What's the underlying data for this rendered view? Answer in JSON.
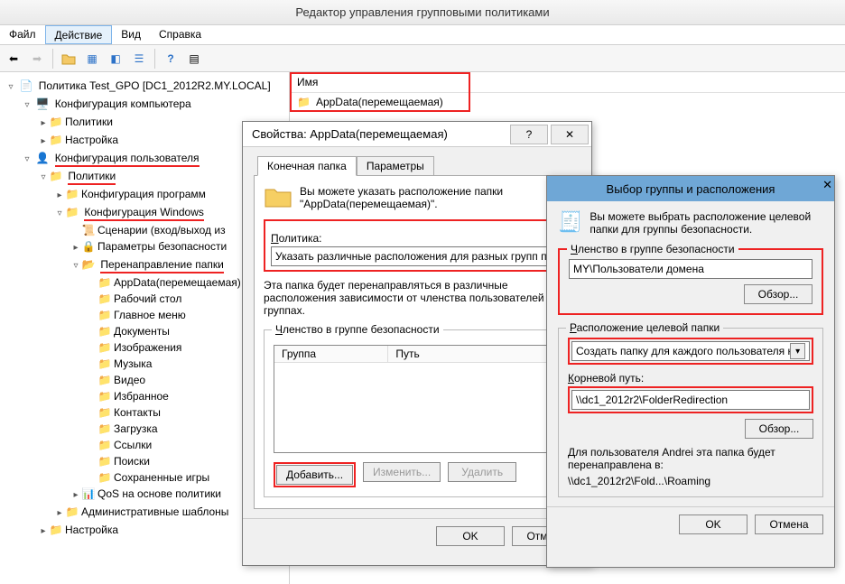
{
  "window_title": "Редактор управления групповыми политиками",
  "menu": {
    "file": "Файл",
    "action": "Действие",
    "view": "Вид",
    "help": "Справка"
  },
  "tree": {
    "root": "Политика Test_GPO [DC1_2012R2.MY.LOCAL]",
    "comp_conf": "Конфигурация компьютера",
    "policies": "Политики",
    "settings": "Настройка",
    "user_conf": "Конфигурация пользователя",
    "policies2": "Политики",
    "prog_conf": "Конфигурация программ",
    "win_conf": "Конфигурация Windows",
    "scripts": "Сценарии (вход/выход из",
    "sec_params": "Параметры безопасности",
    "folder_redir": "Перенаправление папки",
    "appdata": "AppData(перемещаемая)",
    "desktop": "Рабочий стол",
    "startmenu": "Главное меню",
    "documents": "Документы",
    "pictures": "Изображения",
    "music": "Музыка",
    "video": "Видео",
    "favorites": "Избранное",
    "contacts": "Контакты",
    "downloads": "Загрузка",
    "links": "Ссылки",
    "searches": "Поиски",
    "savedgames": "Сохраненные игры",
    "qos": "QoS на основе политики",
    "admtmpl": "Административные шаблоны",
    "settings2": "Настройка"
  },
  "list": {
    "header": "Имя",
    "row1": "AppData(перемещаемая)"
  },
  "props_dialog": {
    "title": "Свойства: AppData(перемещаемая)",
    "tab_target": "Конечная папка",
    "tab_params": "Параметры",
    "hint1": "Вы можете указать расположение папки",
    "hint2": "\"AppData(перемещаемая)\".",
    "policy_label": "Политика:",
    "policy_value": "Указать различные расположения для разных групп пользов",
    "note": "Эта папка будет перенаправляться в различные расположения зависимости от членства пользователей в группах.",
    "group_legend": "Членство в группе безопасности",
    "col_group": "Группа",
    "col_path": "Путь",
    "btn_add": "Добавить...",
    "btn_edit": "Изменить...",
    "btn_del": "Удалить",
    "ok": "OK",
    "cancel": "Отмена"
  },
  "picker_dialog": {
    "title": "Выбор группы и расположения",
    "hint": "Вы можете выбрать расположение целевой папки для группы безопасности.",
    "group_legend": "Членство в группе безопасности",
    "group_value": "MY\\Пользователи домена",
    "browse": "Обзор...",
    "target_legend": "Расположение целевой папки",
    "target_combo": "Создать папку для каждого пользователя на к",
    "root_label": "Корневой путь:",
    "root_value": "\\\\dc1_2012r2\\FolderRedirection",
    "browse2": "Обзор...",
    "for_user": "Для пользователя Andrei эта папка будет перенаправлена в:",
    "result_path": "\\\\dc1_2012r2\\Fold...\\Roaming",
    "ok": "OK",
    "cancel": "Отмена"
  }
}
